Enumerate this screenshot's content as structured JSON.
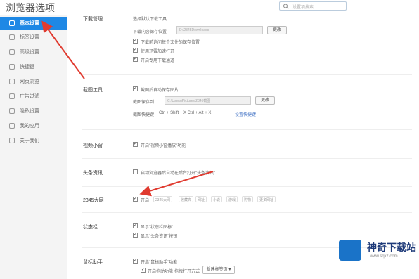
{
  "app": {
    "title": "浏览器选项",
    "search_placeholder": "设置项搜索"
  },
  "sidebar": {
    "items": [
      {
        "label": "基本设置",
        "active": true
      },
      {
        "label": "标签设置"
      },
      {
        "label": "高级设置"
      },
      {
        "label": "快捷键"
      },
      {
        "label": "网页浏览"
      },
      {
        "label": "广告过滤"
      },
      {
        "label": "隐私设置"
      },
      {
        "label": "我的应用"
      },
      {
        "label": "关于我们"
      }
    ]
  },
  "sections": {
    "download": {
      "label": "下载管理",
      "line1": "选择默认下载工具",
      "path_label": "下载内容保存位置",
      "path_value": "D:\\2345Downloads",
      "change_btn": "更改",
      "opt1": "下载前询问每个文件的保存位置",
      "opt2": "使用迅雷加速打开",
      "opt3": "开启专用下载通道"
    },
    "screenshot": {
      "label": "截图工具",
      "opt1": "截图后自动保存图片",
      "save_label": "截图保存到",
      "save_value": "C:\\Users\\Pictures\\2345截图",
      "change_btn": "更改",
      "shortcut_label": "截图快捷键：",
      "shortcut_value": "Ctrl + Shift + X    Ctrl + Alt + X",
      "shortcut_link": "设置快捷键"
    },
    "video": {
      "label": "视频小窗",
      "opt1": "开启\"视频小窗播放\"功能"
    },
    "news": {
      "label": "头条资讯",
      "opt1": "启动浏览器后自动在后台打开\"头条资讯\""
    },
    "favorites": {
      "label": "2345大网",
      "opt1": "开启",
      "pills": [
        "2345大网",
        "收藏夹",
        "网址",
        "小说",
        "游戏",
        "购物",
        "更多网址"
      ]
    },
    "statusbar": {
      "label": "状态栏",
      "opt1": "显示\"状态栏图标\"",
      "opt2": "显示\"头条资讯\"按钮"
    },
    "mouse": {
      "label": "鼠标助手",
      "opt1": "开启\"鼠标助手\"功能",
      "opt2": "开启拖动功能",
      "opt2_label": "拖拽打开方式",
      "select_value": "新建标签页"
    }
  },
  "watermark": {
    "name": "神奇下载站",
    "url": "www.sqxz.com"
  },
  "colors": {
    "accent": "#1e88e5",
    "arrow": "#e03a2f"
  }
}
